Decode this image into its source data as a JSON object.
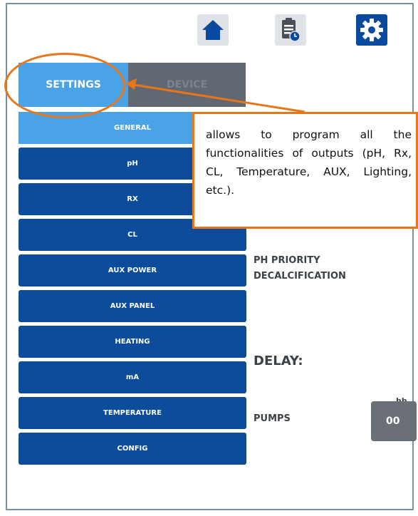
{
  "toolbar": {
    "icons": [
      "home-icon",
      "clipboard-clock-icon",
      "gear-icon"
    ],
    "active": "gear-icon"
  },
  "tabs": [
    {
      "label": "SETTINGS",
      "active": true
    },
    {
      "label": "DEVICE",
      "active": false
    }
  ],
  "menu": {
    "items": [
      "GENERAL",
      "pH",
      "RX",
      "CL",
      "AUX POWER",
      "AUX PANEL",
      "HEATING",
      "mA",
      "TEMPERATURE",
      "CONFIG"
    ],
    "active": "GENERAL"
  },
  "settings": {
    "ph_priority_label": "PH PRIORITY",
    "decalcification_label": "DECALCIFICATION",
    "delay_label": "DELAY:",
    "hh_label": "hh",
    "pumps_label": "PUMPS",
    "pumps_value": "00"
  },
  "callout": {
    "text": "allows to program all the functionalities of outputs (pH, Rx, CL, Temperature, AUX, Lighting, etc.)."
  },
  "colors": {
    "menu_blue": "#0d4c9a",
    "active_blue": "#4aa3e6",
    "annotation_orange": "#e8771c"
  }
}
